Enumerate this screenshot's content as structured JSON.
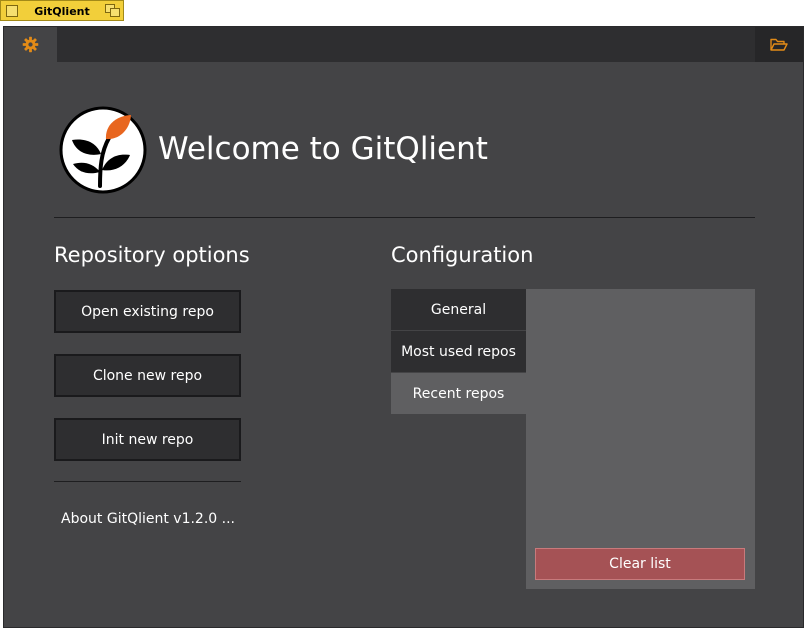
{
  "window": {
    "title": "GitQlient"
  },
  "header": {
    "welcome": "Welcome to GitQlient"
  },
  "repository": {
    "heading": "Repository options",
    "open_label": "Open existing repo",
    "clone_label": "Clone new repo",
    "init_label": "Init new repo",
    "about": "About GitQlient v1.2.0 ..."
  },
  "configuration": {
    "heading": "Configuration",
    "tabs": [
      {
        "label": "General",
        "active": false
      },
      {
        "label": "Most used repos",
        "active": false
      },
      {
        "label": "Recent repos",
        "active": true
      }
    ],
    "clear_label": "Clear list"
  },
  "colors": {
    "accent": "#e38b17",
    "background": "#444446",
    "danger": "#a55255"
  },
  "icons": [
    "gear-icon",
    "folder-open-icon",
    "gitqlient-logo-icon"
  ]
}
